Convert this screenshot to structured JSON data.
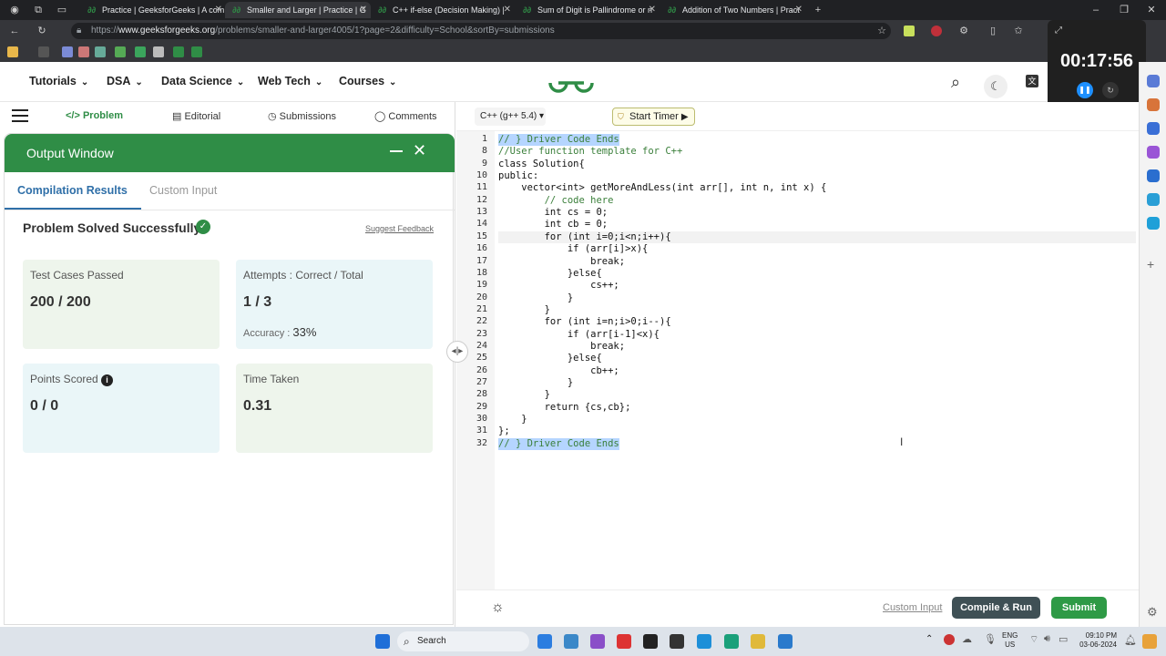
{
  "browser": {
    "tabs": [
      {
        "label": "Practice | GeeksforGeeks | A com",
        "active": false
      },
      {
        "label": "Smaller and Larger | Practice | G",
        "active": true
      },
      {
        "label": "C++ if-else (Decision Making) | ",
        "active": false
      },
      {
        "label": "Sum of Digit is Pallindrome or n",
        "active": false
      },
      {
        "label": "Addition of Two Numbers | Pract",
        "active": false
      }
    ],
    "url_prefix": "https://",
    "url_domain": "www.geeksforgeeks.org",
    "url_path": "/problems/smaller-and-larger4005/1?page=2&difficulty=School&sortBy=submissions"
  },
  "gfg_header": {
    "nav": [
      "Tutorials",
      "DSA",
      "Data Science",
      "Web Tech",
      "Courses"
    ]
  },
  "timer": {
    "time": "00:17:56"
  },
  "problem_tabs": [
    "Problem",
    "Editorial",
    "Submissions",
    "Comments"
  ],
  "output_window": {
    "title": "Output Window",
    "tabs": [
      "Compilation Results",
      "Custom Input"
    ],
    "status": "Problem Solved Successfully",
    "feedback_link": "Suggest Feedback",
    "cards": {
      "test_cases_label": "Test Cases Passed",
      "test_cases_value": "200 / 200",
      "attempts_label": "Attempts : Correct / Total",
      "attempts_value": "1 / 3",
      "accuracy_label": "Accuracy :",
      "accuracy_value": "33%",
      "points_label": "Points Scored",
      "points_value": "0 / 0",
      "time_label": "Time Taken",
      "time_value": "0.31"
    }
  },
  "editor": {
    "language": "C++ (g++ 5.4)",
    "start_timer": "Start Timer",
    "lines": [
      {
        "n": "1",
        "text": "// } Driver Code Ends"
      },
      {
        "n": "8",
        "text": "//User function template for C++"
      },
      {
        "n": "9",
        "text": "class Solution{"
      },
      {
        "n": "10",
        "text": "public:"
      },
      {
        "n": "11",
        "text": "    vector<int> getMoreAndLess(int arr[], int n, int x) {"
      },
      {
        "n": "12",
        "text": "        // code here"
      },
      {
        "n": "13",
        "text": "        int cs = 0;"
      },
      {
        "n": "14",
        "text": "        int cb = 0;"
      },
      {
        "n": "15",
        "text": "        for (int i=0;i<n;i++){"
      },
      {
        "n": "16",
        "text": "            if (arr[i]>x){"
      },
      {
        "n": "17",
        "text": "                break;"
      },
      {
        "n": "18",
        "text": "            }else{"
      },
      {
        "n": "19",
        "text": "                cs++;"
      },
      {
        "n": "20",
        "text": "            }"
      },
      {
        "n": "21",
        "text": "        }"
      },
      {
        "n": "22",
        "text": "        for (int i=n;i>0;i--){"
      },
      {
        "n": "23",
        "text": "            if (arr[i-1]<x){"
      },
      {
        "n": "24",
        "text": "                break;"
      },
      {
        "n": "25",
        "text": "            }else{"
      },
      {
        "n": "26",
        "text": "                cb++;"
      },
      {
        "n": "27",
        "text": "            }"
      },
      {
        "n": "28",
        "text": "        }"
      },
      {
        "n": "29",
        "text": "        return {cs,cb};"
      },
      {
        "n": "30",
        "text": "    }"
      },
      {
        "n": "31",
        "text": "};"
      },
      {
        "n": "32",
        "text": "// } Driver Code Ends"
      }
    ],
    "custom_input": "Custom Input",
    "compile_run": "Compile & Run",
    "submit": "Submit"
  },
  "taskbar": {
    "search": "Search",
    "lang_1": "ENG",
    "lang_2": "US",
    "time": "09:10 PM",
    "date": "03-06-2024"
  },
  "colors": {
    "gfg_green": "#2f8d46",
    "submit_green": "#2e9a46",
    "compile_gray": "#3f5055"
  }
}
